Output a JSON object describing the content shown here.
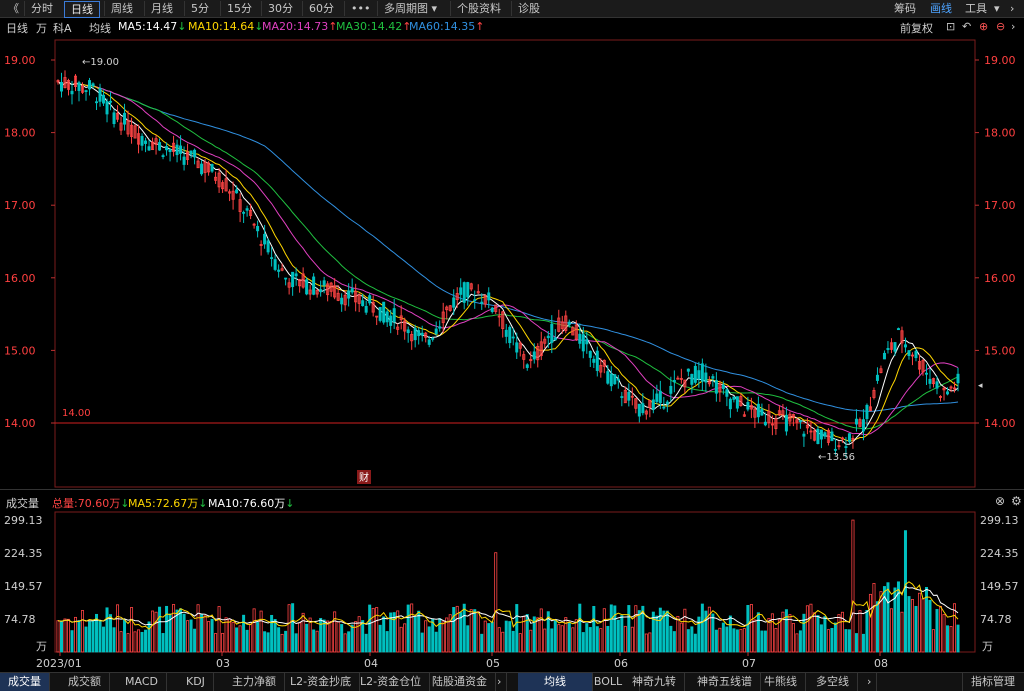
{
  "toolbar": {
    "back": "《",
    "periods": [
      "分时",
      "日线",
      "周线",
      "月线",
      "5分",
      "15分",
      "30分",
      "60分"
    ],
    "active_period": "日线",
    "more": "•••",
    "multi_period": "多周期图",
    "stock_info": "个股资料",
    "diagnose": "诊股",
    "right_items": [
      "筹码",
      "画线",
      "工具"
    ]
  },
  "info": {
    "label": "日线",
    "unit": "万",
    "name": "科A",
    "avg_label": "均线",
    "ma5": "MA5:14.47",
    "ma10": "MA10:14.64",
    "ma20": "MA20:14.73",
    "ma30": "MA30:14.42",
    "ma60": "MA60:14.35",
    "adjust": "前复权"
  },
  "colors": {
    "up": "#ff4444",
    "down": "#00c0c0",
    "ma5": "#ffffff",
    "ma10": "#ffd700",
    "ma20": "#e040c0",
    "ma30": "#20c040",
    "ma60": "#3090e0"
  },
  "chart_data": {
    "type": "candlestick",
    "price_axis": {
      "ticks": [
        "19.00",
        "18.00",
        "17.00",
        "16.00",
        "15.00",
        "14.00"
      ],
      "ylim": [
        13.4,
        19.1
      ]
    },
    "high_annotation": "19.00",
    "low_annotation": "13.56",
    "level_line": {
      "label": "14.00",
      "value": 14.0
    },
    "finance_marker": "财",
    "x_ticks": [
      "2023/01",
      "03",
      "04",
      "05",
      "06",
      "07",
      "08"
    ],
    "volume_panel": {
      "title": "成交量",
      "total": "总量:70.60万",
      "ma5": "MA5:72.67万",
      "ma10": "MA10:76.60万",
      "ticks": [
        "299.13",
        "224.35",
        "149.57",
        "74.78"
      ],
      "unit": "万",
      "ylim": [
        0,
        299.13
      ]
    }
  },
  "bottom_tabs": [
    "成交量",
    "成交额",
    "MACD",
    "KDJ",
    "主力净额",
    "L2-资金抄底",
    "L2-资金仓位",
    "陆股通资金",
    "均线",
    "BOLL",
    "神奇九转",
    "神奇五线谱",
    "牛熊线",
    "多空线",
    "指标管理"
  ],
  "active_tab_left": "成交量",
  "active_tab_right": "均线"
}
